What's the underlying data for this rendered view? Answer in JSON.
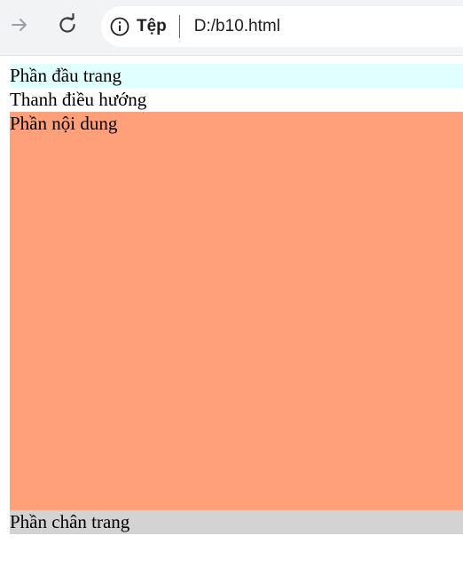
{
  "browser": {
    "site_info_label": "Tệp",
    "url": "D:/b10.html",
    "icons": {
      "forward": "arrow-right-icon",
      "reload": "reload-icon",
      "info": "info-icon"
    }
  },
  "page": {
    "header_text": "Phần đầu trang",
    "nav_text": "Thanh điều hướng",
    "content_text": "Phần nội dung",
    "footer_text": "Phần chân trang",
    "colors": {
      "header_bg": "#e0ffff",
      "content_bg": "#ffa07a",
      "footer_bg": "#d3d3d3"
    }
  }
}
